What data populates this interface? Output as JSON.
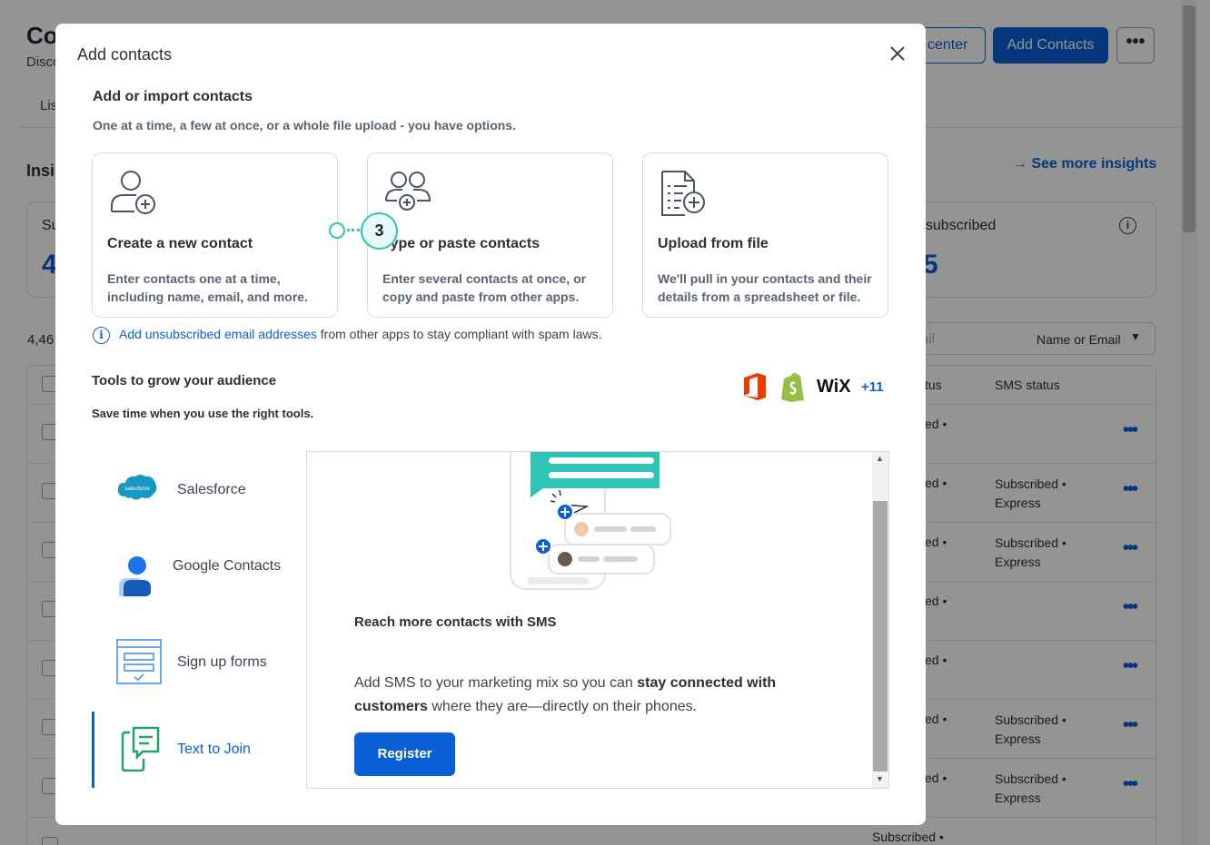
{
  "background": {
    "title": "Co",
    "subtitle": "Disco",
    "tab": "Lis",
    "insights_label": "Insig",
    "help_center_label": "center",
    "add_contacts_label": "Add Contacts",
    "more_label": "•••",
    "see_more_insights": "See more insights",
    "stat_left_label": "Su",
    "stat_left_value": "4",
    "stat_right_label": "nsubscribed",
    "stat_right_value": "5",
    "contact_count": "4,46",
    "search_placeholder": "ail",
    "search_filter": "Name or Email",
    "table_headers": {
      "status": "tus",
      "sms_status": "SMS status"
    },
    "rows": [
      {
        "email_status": "ed •",
        "sms_status": ""
      },
      {
        "email_status": "ed •",
        "sms_status": "Subscribed • Express"
      },
      {
        "email_status": "ed •",
        "sms_status": "Subscribed • Express"
      },
      {
        "email_status": "ed •",
        "sms_status": ""
      },
      {
        "email_status": "ed •",
        "sms_status": ""
      },
      {
        "email_status": "ed •",
        "sms_status": "Subscribed • Express"
      },
      {
        "email_status": "ed •",
        "sms_status": "Subscribed • Express"
      },
      {
        "email_status": "Subscribed •",
        "sms_status": ""
      }
    ]
  },
  "modal": {
    "title": "Add contacts",
    "close_icon": "close-icon",
    "import_section": {
      "title": "Add or import contacts",
      "subtitle": "One at a time, a few at once, or a whole file upload - you have options."
    },
    "options": [
      {
        "icon": "person-add-icon",
        "title": "Create a new contact",
        "description": "Enter contacts one at a time, including name, email, and more."
      },
      {
        "icon": "people-add-icon",
        "title": "Type or paste contacts",
        "description": "Enter several contacts at once, or copy and paste from other apps."
      },
      {
        "icon": "file-add-icon",
        "title": "Upload from file",
        "description": "We'll pull in your contacts and their details from a spreadsheet or file."
      }
    ],
    "step_badge": "3",
    "info": {
      "link_text": "Add unsubscribed email addresses",
      "text": " from other apps to stay compliant with spam laws."
    },
    "tools_section": {
      "title": "Tools to grow your audience",
      "subtitle": "Save time when you use the right tools.",
      "logos": [
        "office-logo-icon",
        "shopify-logo-icon",
        "WiX"
      ],
      "more_count": "+11"
    },
    "tools": [
      {
        "icon": "salesforce-icon",
        "label": "Salesforce"
      },
      {
        "icon": "google-contacts-icon",
        "label": "Google Contacts"
      },
      {
        "icon": "signup-form-icon",
        "label": "Sign up forms"
      },
      {
        "icon": "text-to-join-icon",
        "label": "Text to Join",
        "active": true
      }
    ],
    "panel": {
      "heading": "Reach more contacts with SMS",
      "body_1": "Add SMS to your marketing mix so you can ",
      "body_bold_1": "stay connected with customers",
      "body_2": " where they are—directly on their phones.",
      "button": "Register"
    }
  },
  "colors": {
    "accent": "#0b5fd6",
    "teal": "#2ec4b6",
    "overlay": "rgba(0,0,0,0.42)"
  }
}
